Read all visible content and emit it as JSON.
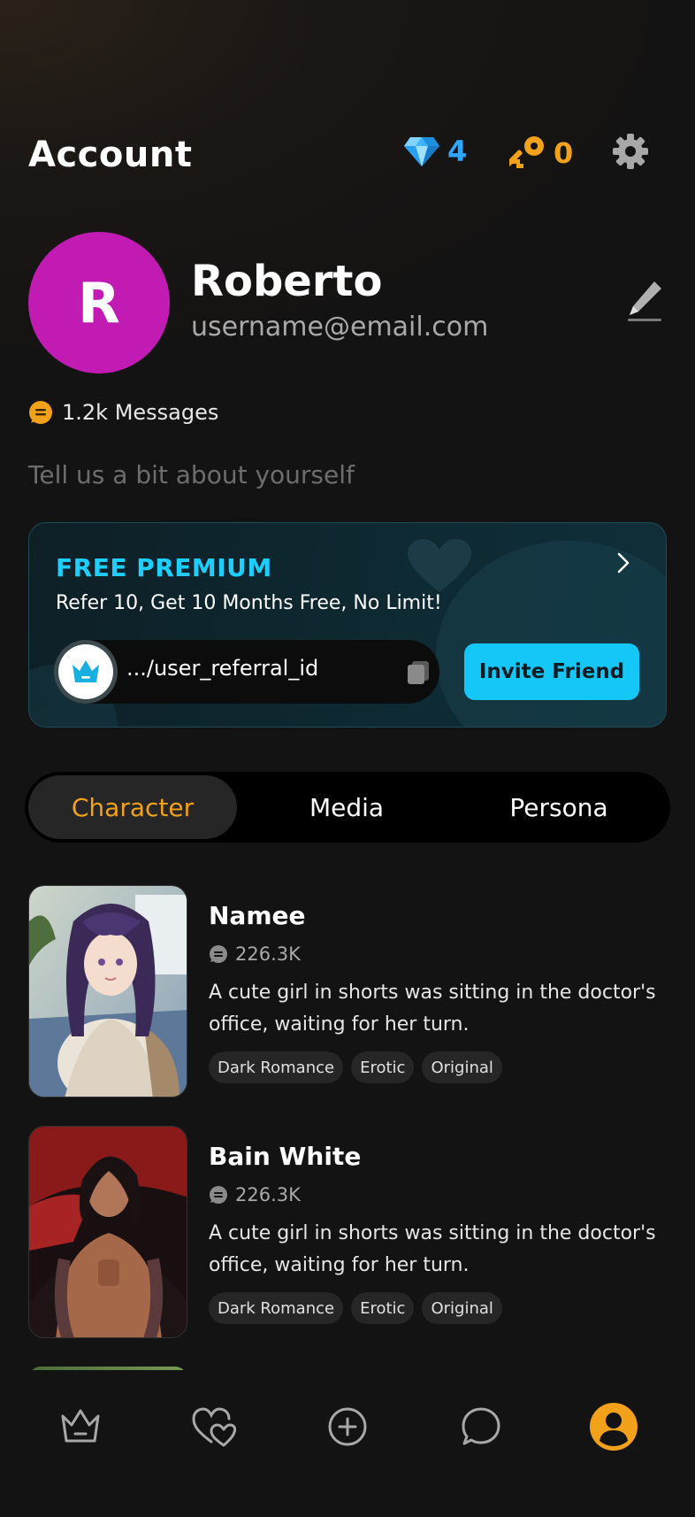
{
  "header": {
    "title": "Account",
    "gems": "4",
    "keys": "0"
  },
  "profile": {
    "initial": "R",
    "name": "Roberto",
    "email": "username@email.com",
    "avatar_color": "#c21bb4",
    "messages": "1.2k Messages",
    "bio_placeholder": "Tell us a bit about yourself"
  },
  "referral": {
    "title": "FREE PREMIUM",
    "subtitle": "Refer 10, Get 10 Months Free, No Limit!",
    "link": ".../user_referral_id",
    "invite_label": "Invite Friend",
    "accent": "#14c7f7"
  },
  "tabs": [
    {
      "label": "Character",
      "active": true
    },
    {
      "label": "Media",
      "active": false
    },
    {
      "label": "Persona",
      "active": false
    }
  ],
  "characters": [
    {
      "name": "Namee",
      "count": "226.3K",
      "description": "A cute girl in shorts was sitting in the doctor's office, waiting for her turn.",
      "tags": [
        "Dark Romance",
        "Erotic",
        "Original"
      ]
    },
    {
      "name": "Bain White",
      "count": "226.3K",
      "description": "A cute girl in shorts was sitting in the doctor's office, waiting for her turn.",
      "tags": [
        "Dark Romance",
        "Erotic",
        "Original"
      ]
    }
  ],
  "nav": {
    "items": [
      "crown-icon",
      "hearts-icon",
      "plus-circle-icon",
      "chat-icon",
      "profile-icon"
    ],
    "active": "profile-icon",
    "accent": "#f2a21a"
  }
}
